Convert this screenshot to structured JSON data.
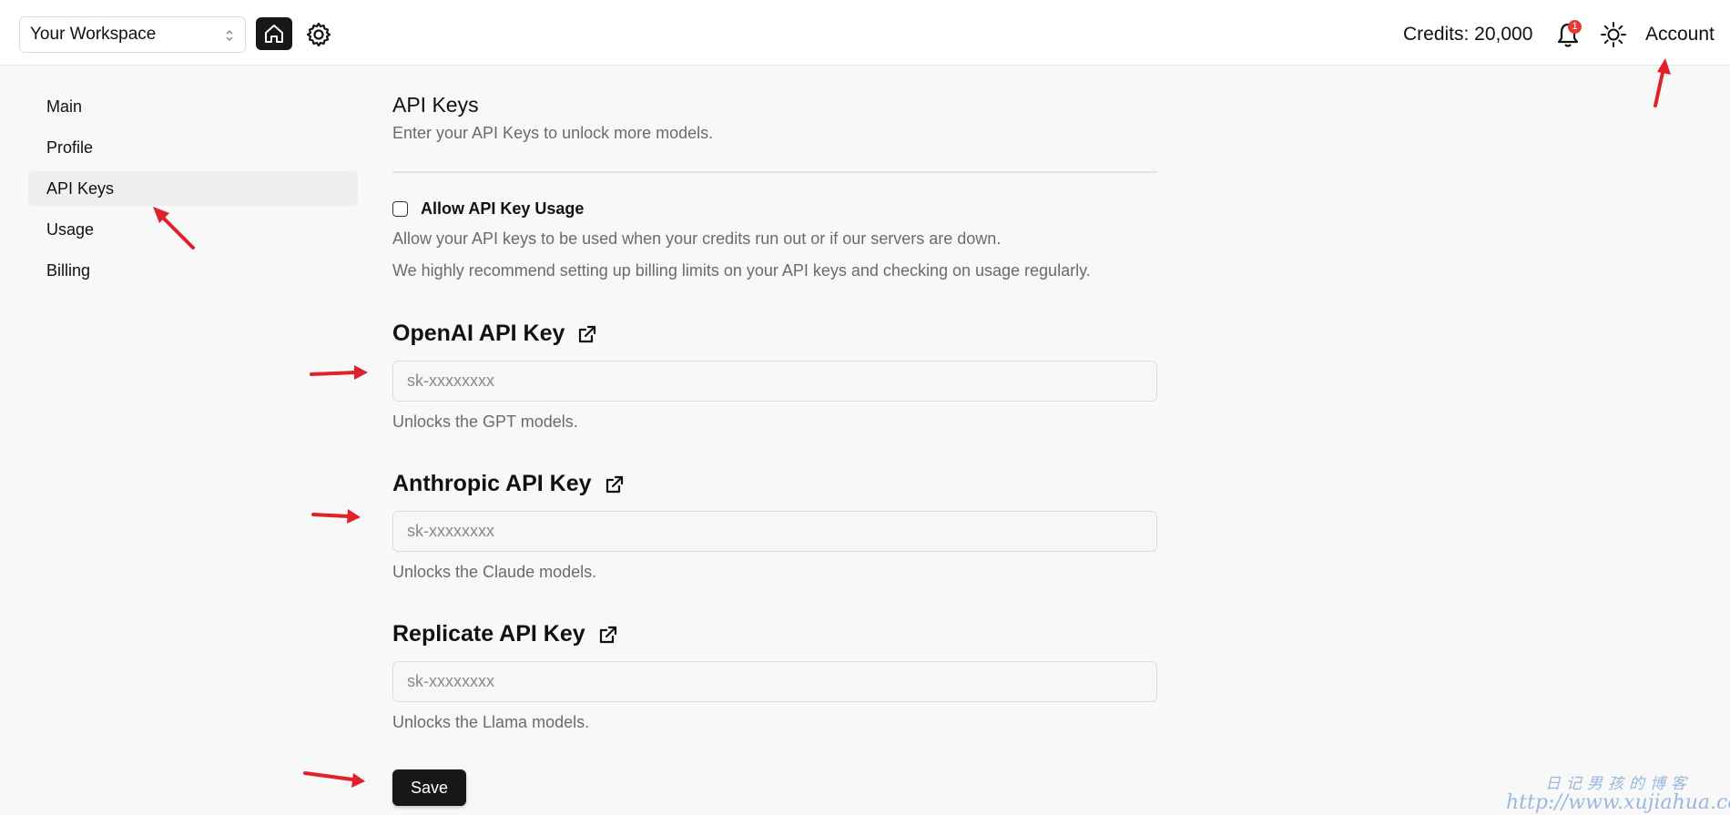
{
  "header": {
    "workspace": "Your Workspace",
    "credits": "Credits: 20,000",
    "notification_count": "1",
    "account": "Account"
  },
  "sidebar": {
    "items": [
      {
        "label": "Main"
      },
      {
        "label": "Profile"
      },
      {
        "label": "API Keys"
      },
      {
        "label": "Usage"
      },
      {
        "label": "Billing"
      }
    ]
  },
  "main": {
    "title": "API Keys",
    "subtitle": "Enter your API Keys to unlock more models.",
    "allow_label": "Allow API Key Usage",
    "allow_checked": false,
    "allow_desc1": "Allow your API keys to be used when your credits run out or if our servers are down.",
    "allow_desc2": "We highly recommend setting up billing limits on your API keys and checking on usage regularly.",
    "keys": [
      {
        "heading": "OpenAI API Key",
        "placeholder": "sk-xxxxxxxx",
        "value": "",
        "help": "Unlocks the GPT models."
      },
      {
        "heading": "Anthropic API Key",
        "placeholder": "sk-xxxxxxxx",
        "value": "",
        "help": "Unlocks the Claude models."
      },
      {
        "heading": "Replicate API Key",
        "placeholder": "sk-xxxxxxxx",
        "value": "",
        "help": "Unlocks the Llama models."
      }
    ],
    "save_label": "Save"
  },
  "watermark": {
    "line1": "日记男孩的博客",
    "line2": "http://www.xujiahua.com"
  },
  "colors": {
    "annotation_arrow": "#e0202b",
    "primary_button": "#171717",
    "badge": "#e53935"
  }
}
